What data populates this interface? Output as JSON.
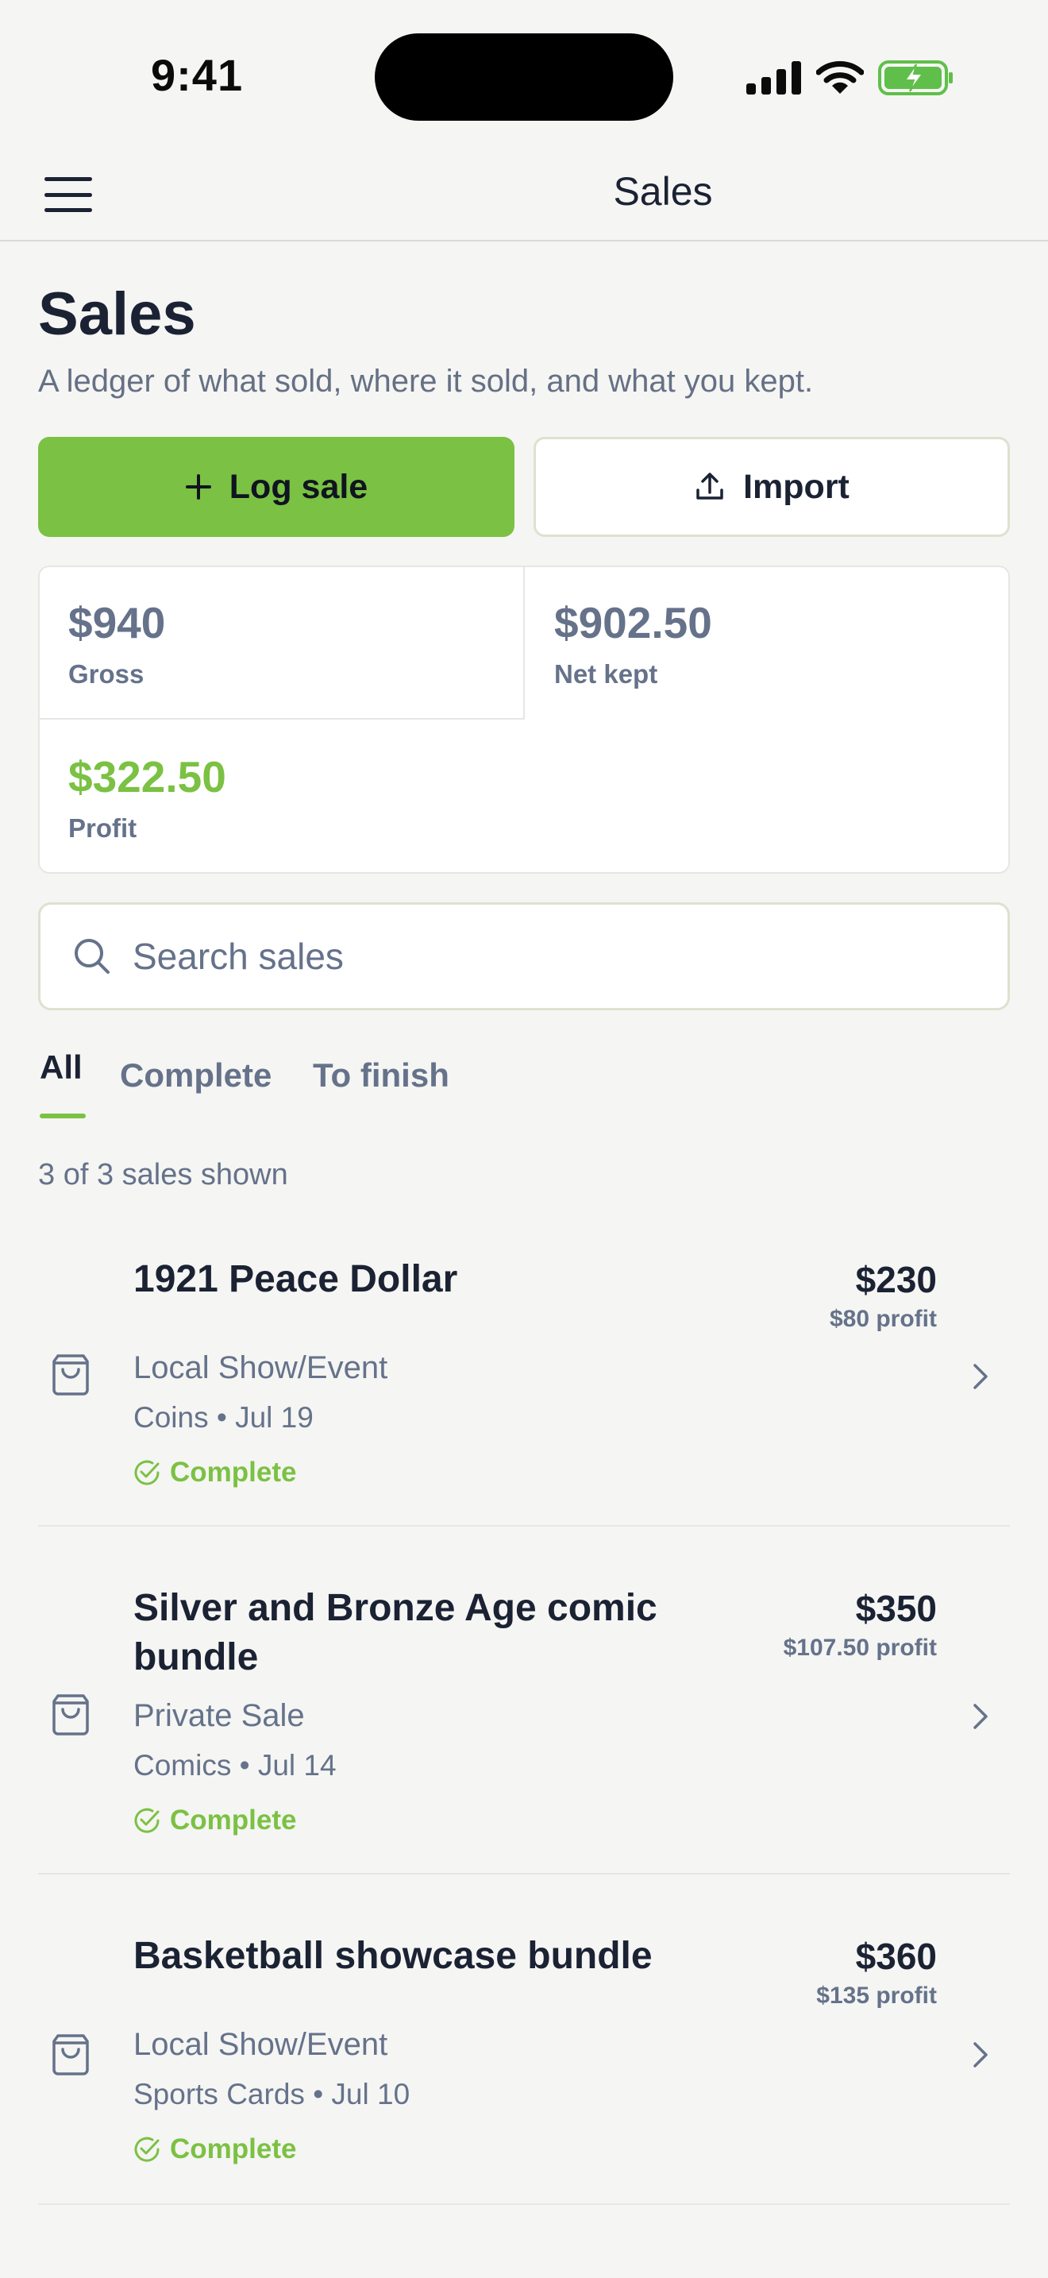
{
  "status_bar": {
    "time": "9:41"
  },
  "nav": {
    "title": "Sales"
  },
  "header": {
    "title": "Sales",
    "subtitle": "A ledger of what sold, where it sold, and what you kept."
  },
  "actions": {
    "log_sale": "Log sale",
    "import": "Import"
  },
  "stats": {
    "gross_value": "$940",
    "gross_label": "Gross",
    "net_value": "$902.50",
    "net_label": "Net kept",
    "profit_value": "$322.50",
    "profit_label": "Profit"
  },
  "search": {
    "placeholder": "Search sales"
  },
  "tabs": [
    {
      "label": "All",
      "active": true
    },
    {
      "label": "Complete",
      "active": false
    },
    {
      "label": "To finish",
      "active": false
    }
  ],
  "count_text": "3 of 3 sales shown",
  "sales": [
    {
      "title": "1921 Peace Dollar",
      "price": "$230",
      "profit": "$80 profit",
      "source": "Local Show/Event",
      "category": "Coins",
      "date": "Jul 19",
      "meta": "Coins • Jul 19",
      "status": "Complete"
    },
    {
      "title_line1": "Silver and Bronze Age comic",
      "title_line2": "bundle",
      "price": "$350",
      "profit": "$107.50 profit",
      "source": "Private Sale",
      "category": "Comics",
      "date": "Jul 14",
      "meta": "Comics • Jul 14",
      "status": "Complete"
    },
    {
      "title": "Basketball showcase bundle",
      "price": "$360",
      "profit": "$135 profit",
      "source": "Local Show/Event",
      "category": "Sports Cards",
      "date": "Jul 10",
      "meta": "Sports Cards • Jul 10",
      "status": "Complete"
    }
  ],
  "colors": {
    "accent": "#7bc143",
    "text": "#1b2233",
    "muted": "#65728a",
    "background": "#f5f5f3"
  }
}
